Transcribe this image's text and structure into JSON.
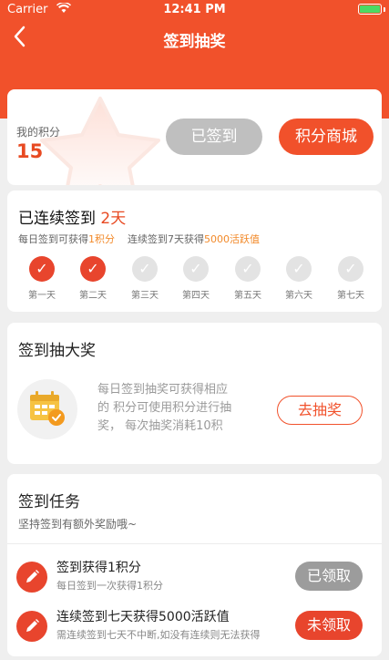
{
  "status_bar": {
    "carrier": "Carrier",
    "time": "12:41 PM"
  },
  "nav": {
    "title": "签到抽奖"
  },
  "points": {
    "label": "我的积分",
    "value": "15",
    "signed_button": "已签到",
    "mall_button": "积分商城"
  },
  "streak": {
    "title_prefix": "已连续签到 ",
    "days_text": "2天",
    "info_daily_prefix": "每日签到可获得",
    "info_daily_hl": "1积分",
    "info_week_prefix": "连续签到7天获得",
    "info_week_hl": "5000活跃值",
    "days": [
      {
        "label": "第一天",
        "done": true
      },
      {
        "label": "第二天",
        "done": true
      },
      {
        "label": "第三天",
        "done": false
      },
      {
        "label": "第四天",
        "done": false
      },
      {
        "label": "第五天",
        "done": false
      },
      {
        "label": "第六天",
        "done": false
      },
      {
        "label": "第七天",
        "done": false
      }
    ]
  },
  "lottery": {
    "title": "签到抽大奖",
    "desc_lines": [
      "每日签到抽奖可获得相应",
      "的 积分可使用积分进行抽",
      "奖， 每次抽奖消耗10积"
    ],
    "button": "去抽奖"
  },
  "tasks": {
    "title": "签到任务",
    "subtitle": "坚持签到有额外奖励哦~",
    "items": [
      {
        "title": "签到获得1积分",
        "desc": "每日签到一次获得1积分",
        "button": "已领取",
        "claimed": true
      },
      {
        "title": "连续签到七天获得5000活跃值",
        "desc": "需连续签到七天不中断,如没有连续则无法获得",
        "button": "未领取",
        "claimed": false
      }
    ]
  },
  "colors": {
    "brand": "#f1512b",
    "accent_text": "#e84a22",
    "highlight": "#f28a2a",
    "done": "#e8452d",
    "inactive": "#e3e3e3"
  }
}
